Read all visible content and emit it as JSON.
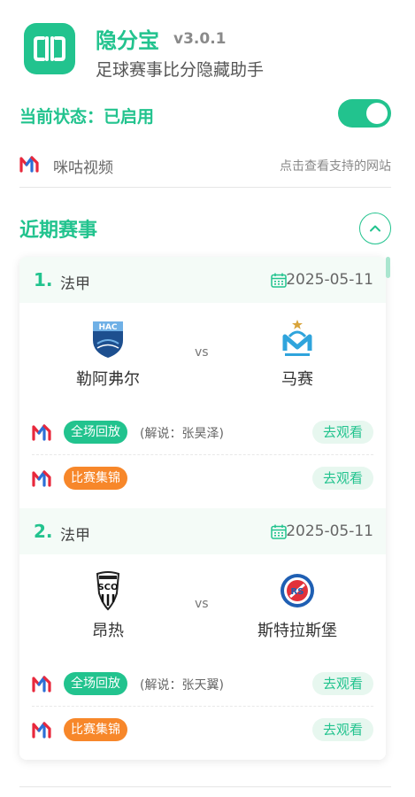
{
  "app": {
    "title": "隐分宝",
    "version": "v3.0.1",
    "subtitle": "足球赛事比分隐藏助手",
    "accent": "#22c38e"
  },
  "status": {
    "label": "当前状态：已启用",
    "enabled": true
  },
  "site": {
    "name": "咪咕视频",
    "link": "点击查看支持的网站",
    "icon": "migu-logo-icon"
  },
  "section": {
    "title": "近期赛事",
    "collapse_icon": "chevron-up-icon"
  },
  "matches": [
    {
      "index": "1.",
      "league": "法甲",
      "date": "2025-05-11",
      "home": "勒阿弗尔",
      "away": "马赛",
      "vs": "vs",
      "replay": {
        "tag": "全场回放",
        "commentary": "(解说：张昊泽)",
        "button": "去观看"
      },
      "highlights": {
        "tag": "比赛集锦",
        "button": "去观看"
      }
    },
    {
      "index": "2.",
      "league": "法甲",
      "date": "2025-05-11",
      "home": "昂热",
      "away": "斯特拉斯堡",
      "vs": "vs",
      "replay": {
        "tag": "全场回放",
        "commentary": "(解说：张天翼)",
        "button": "去观看"
      },
      "highlights": {
        "tag": "比赛集锦",
        "button": "去观看"
      }
    }
  ],
  "colors": {
    "replay_tag": "#22c38e",
    "highlights_tag": "#f7872a",
    "watch_button_bg": "#e7f7ef"
  }
}
